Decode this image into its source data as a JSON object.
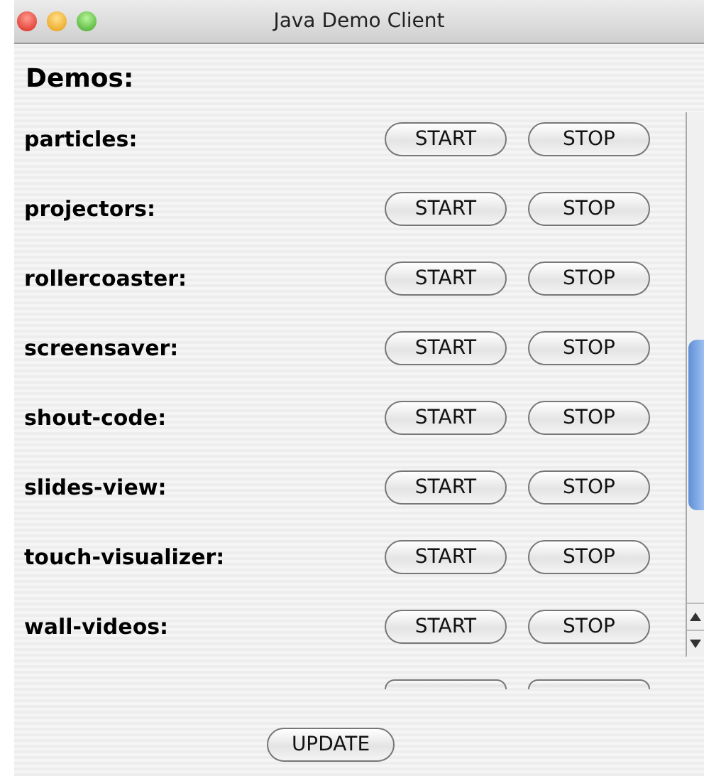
{
  "window": {
    "title": "Java Demo Client"
  },
  "heading": "Demos:",
  "demos": [
    {
      "name": "particles:",
      "start": "START",
      "stop": "STOP"
    },
    {
      "name": "projectors:",
      "start": "START",
      "stop": "STOP"
    },
    {
      "name": "rollercoaster:",
      "start": "START",
      "stop": "STOP"
    },
    {
      "name": "screensaver:",
      "start": "START",
      "stop": "STOP"
    },
    {
      "name": "shout-code:",
      "start": "START",
      "stop": "STOP"
    },
    {
      "name": "slides-view:",
      "start": "START",
      "stop": "STOP"
    },
    {
      "name": "touch-visualizer:",
      "start": "START",
      "stop": "STOP"
    },
    {
      "name": "wall-videos:",
      "start": "START",
      "stop": "STOP"
    }
  ],
  "update_button": "UPDATE"
}
